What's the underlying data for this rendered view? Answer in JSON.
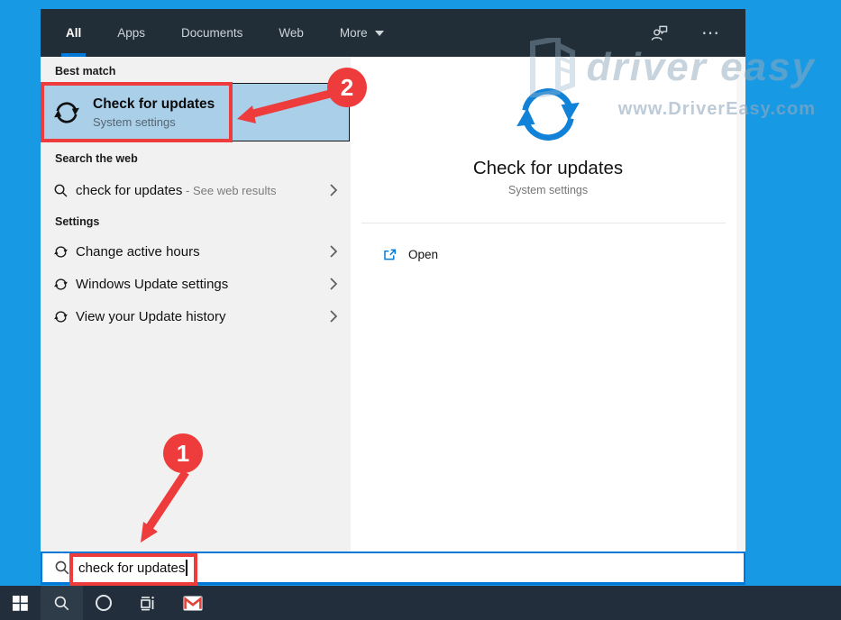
{
  "header": {
    "tabs": [
      {
        "label": "All",
        "active": true
      },
      {
        "label": "Apps",
        "active": false
      },
      {
        "label": "Documents",
        "active": false
      },
      {
        "label": "Web",
        "active": false
      },
      {
        "label": "More",
        "active": false
      }
    ],
    "ellipsis_glyph": "⋯"
  },
  "left_panel": {
    "best_match": {
      "section_label": "Best match",
      "item": {
        "title": "Check for updates",
        "subtitle": "System settings",
        "icon": "sync-icon"
      }
    },
    "search_web": {
      "section_label": "Search the web",
      "item": {
        "query": "check for updates",
        "suffix": " - See web results",
        "icon": "search-icon"
      }
    },
    "settings": {
      "section_label": "Settings",
      "items": [
        {
          "label": "Change active hours",
          "icon": "sync-icon"
        },
        {
          "label": "Windows Update settings",
          "icon": "sync-icon"
        },
        {
          "label": "View your Update history",
          "icon": "sync-icon"
        }
      ]
    }
  },
  "detail_panel": {
    "title": "Check for updates",
    "subtitle": "System settings",
    "icon": "sync-icon",
    "actions": [
      {
        "label": "Open",
        "icon": "open-in-new-icon"
      }
    ]
  },
  "search_bar": {
    "value": "check for updates",
    "icon": "search-icon"
  },
  "annotations": {
    "step1": "1",
    "step2": "2",
    "color": "#ee3b3b"
  },
  "watermark": {
    "brand": "driver easy",
    "url": "www.DriverEasy.com"
  },
  "colors": {
    "accent": "#0078d7",
    "desktop": "#1899e3",
    "header_bg": "#212e37",
    "taskbar_bg": "#222e3c",
    "highlight_row": "#a9cfe9",
    "annotation_red": "#ee3b3b",
    "detail_icon_blue": "#1182d8"
  }
}
